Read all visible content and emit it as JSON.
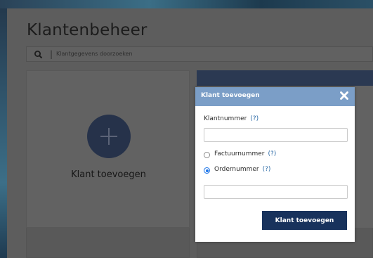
{
  "page": {
    "title": "Klantenbeheer",
    "search_placeholder": "Klantgegevens doorzoeken",
    "search_separator": "|"
  },
  "card": {
    "label": "Klant toevoegen"
  },
  "modal": {
    "title": "Klant toevoegen",
    "customer_number_label": "Klantnummer",
    "customer_number_value": "",
    "help_text": "(?)",
    "options": [
      {
        "label": "Factuurnummer",
        "checked": false
      },
      {
        "label": "Ordernummer",
        "checked": true
      }
    ],
    "reference_value": "",
    "submit_label": "Klant toevoegen"
  },
  "colors": {
    "modal_header": "#7b9ec7",
    "submit_button": "#18325c",
    "help_link": "#2b6aa6",
    "radio_checked": "#1a73e8"
  },
  "icons": [
    "search-icon",
    "close-icon",
    "plus-icon"
  ]
}
